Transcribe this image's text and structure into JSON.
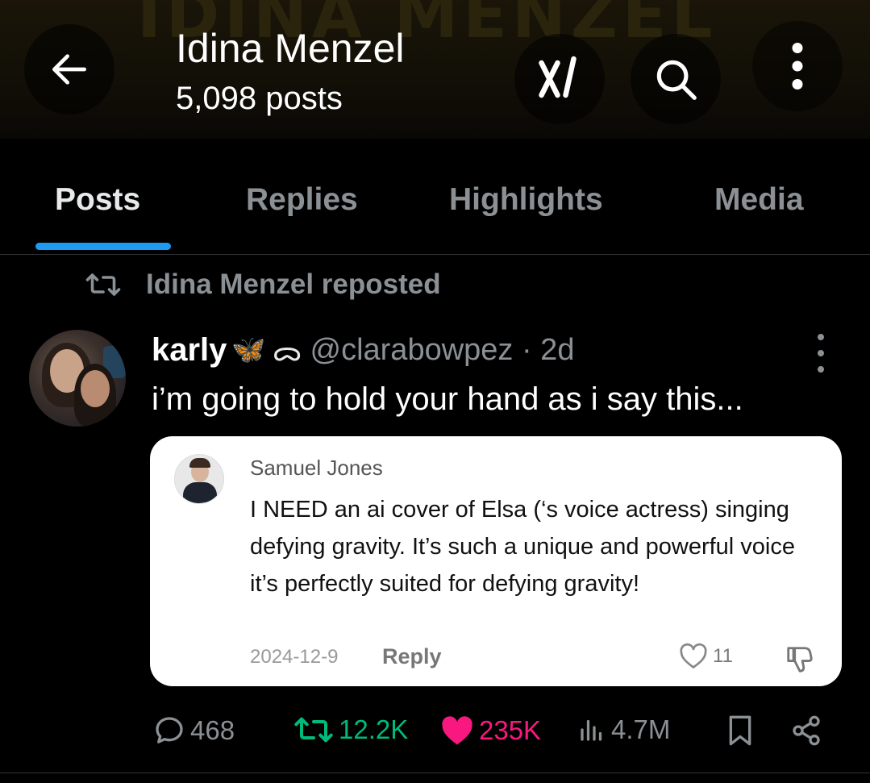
{
  "header": {
    "banner_text": "IDINA MENZEL",
    "profile_name": "Idina Menzel",
    "post_count": "5,098 posts",
    "icons": [
      "arrow-left-icon",
      "grok-icon",
      "search-icon",
      "more-vertical-icon"
    ]
  },
  "tabs": [
    {
      "label": "Posts",
      "active": true
    },
    {
      "label": "Replies",
      "active": false
    },
    {
      "label": "Highlights",
      "active": false
    },
    {
      "label": "Media",
      "active": false
    }
  ],
  "repost_banner": {
    "text": "Idina Menzel reposted",
    "icon": "repost-icon"
  },
  "post": {
    "author_name": "karly",
    "author_emoji": "🦋",
    "author_symbol": "ᯅ",
    "handle_time": "@clarabowpez · 2d",
    "text": "i’m going to hold your hand as i say this...",
    "quoted": {
      "name": "Samuel Jones",
      "body": "I NEED an ai cover of Elsa (‘s voice actress) singing defying gravity. It’s such a unique and powerful voice it’s perfectly suited for defying gravity!",
      "date": "2024-12-9",
      "reply_label": "Reply",
      "like_count": "11"
    },
    "stats": {
      "replies": "468",
      "reposts": "12.2K",
      "likes": "235K",
      "views": "4.7M"
    }
  },
  "colors": {
    "background": "#000000",
    "accent_blue": "#1d9bf0",
    "repost_green": "#00ba7c",
    "like_pink": "#f91880",
    "muted": "#8b9095"
  }
}
